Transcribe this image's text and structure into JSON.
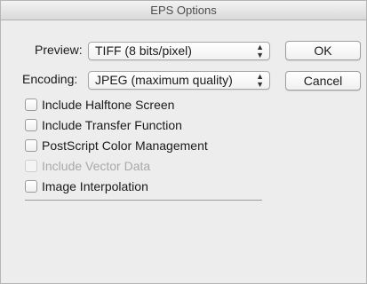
{
  "dialog": {
    "title": "EPS Options"
  },
  "preview": {
    "label": "Preview:",
    "value": "TIFF  (8 bits/pixel)",
    "arrows_up": "▲",
    "arrows_down": "▼"
  },
  "encoding": {
    "label": "Encoding:",
    "value": "JPEG  (maximum quality)",
    "arrows_up": "▲",
    "arrows_down": "▼"
  },
  "buttons": {
    "ok": "OK",
    "cancel": "Cancel"
  },
  "options": [
    {
      "label": "Include Halftone Screen",
      "checked": false,
      "enabled": true
    },
    {
      "label": "Include Transfer Function",
      "checked": false,
      "enabled": true
    },
    {
      "label": "PostScript Color Management",
      "checked": false,
      "enabled": true
    },
    {
      "label": "Include Vector Data",
      "checked": false,
      "enabled": false
    },
    {
      "label": "Image Interpolation",
      "checked": false,
      "enabled": true
    }
  ]
}
